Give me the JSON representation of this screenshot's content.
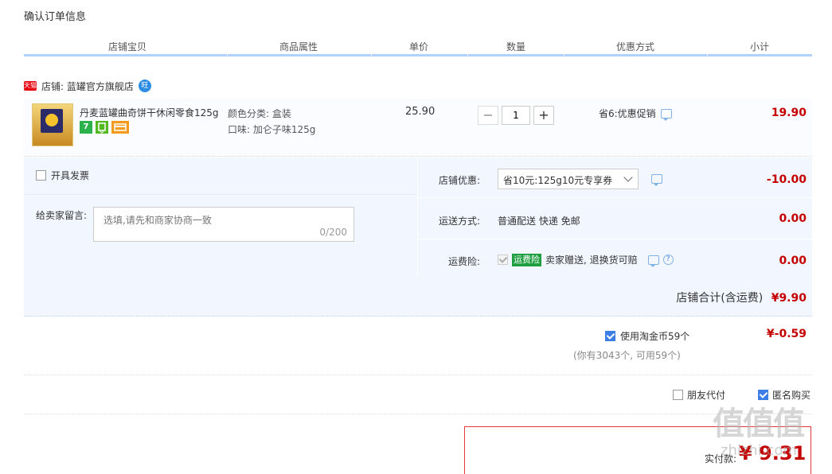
{
  "page_title": "确认订单信息",
  "columns": [
    "店铺宝贝",
    "商品属性",
    "单价",
    "数量",
    "优惠方式",
    "小计"
  ],
  "shop": {
    "tmall_badge": "天猫",
    "label": "店铺: 蓝罐官方旗舰店",
    "wang_icon": "旺"
  },
  "item": {
    "name": "丹麦蓝罐曲奇饼干休闲零食125g",
    "badge_7": "7",
    "attr_color": "颜色分类: 盒装",
    "attr_taste": "口味: 加仑子味125g",
    "price": "25.90",
    "quantity": "1",
    "qty_minus": "−",
    "qty_plus": "+",
    "promo": "省6:优惠促销",
    "subtotal": "19.90"
  },
  "invoice_label": "开具发票",
  "memo": {
    "label": "给卖家留言:",
    "placeholder": "选填,请先和商家协商一致",
    "count": "0/200"
  },
  "shop_discount": {
    "label": "店铺优惠:",
    "selected": "省10元:125g10元专享券",
    "amount": "-10.00"
  },
  "shipping": {
    "label": "运送方式:",
    "value": "普通配送 快递 免邮",
    "amount": "0.00"
  },
  "insurance": {
    "label": "运费险:",
    "tag": "运费险",
    "text": "卖家赠送, 退换货可赔",
    "help": "?",
    "amount": "0.00"
  },
  "shop_total": {
    "label": "店铺合计(含运费)",
    "amount": "¥9.90"
  },
  "coins": {
    "label": "使用淘金币59个",
    "sub": "(你有3043个, 可用59个)",
    "amount": "¥-0.59"
  },
  "friend_pay": "朋友代付",
  "anonymous": "匿名购买",
  "pay": {
    "label": "实付款:",
    "amount": "¥ 9.31"
  },
  "watermark": "值",
  "watermark_url": "zhizhi.com",
  "colors": {
    "accent_red": "#c40000",
    "header_line": "#b2d1ff",
    "panel_bg": "#f2f7ff",
    "checkbox_blue": "#3d7ee6"
  }
}
